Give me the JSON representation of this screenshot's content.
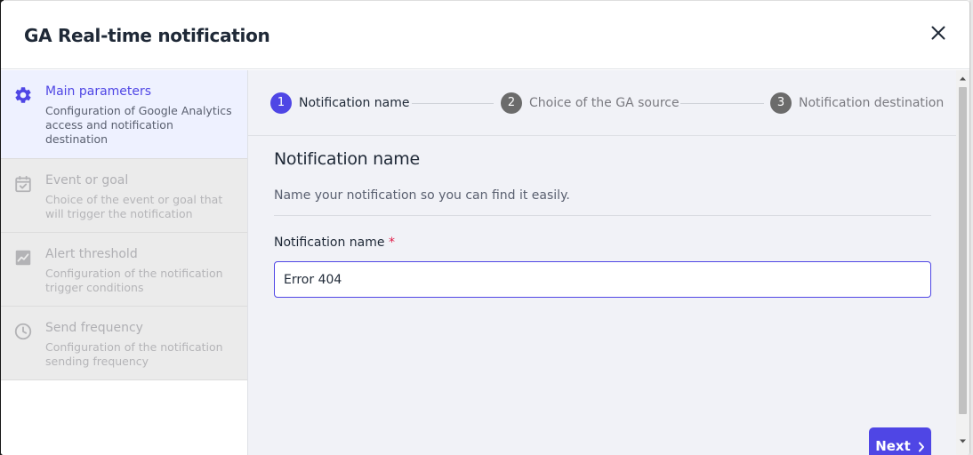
{
  "dialog": {
    "title": "GA Real-time notification"
  },
  "sidebar": {
    "items": [
      {
        "title": "Main parameters",
        "description": "Configuration of Google Analytics access and notification destination",
        "icon": "gear-icon",
        "active": true
      },
      {
        "title": "Event or goal",
        "description": "Choice of the event or goal that will trigger the notification",
        "icon": "calendar-check-icon",
        "active": false
      },
      {
        "title": "Alert threshold",
        "description": "Configuration of the notification trigger conditions",
        "icon": "chart-trend-icon",
        "active": false
      },
      {
        "title": "Send frequency",
        "description": "Configuration of the notification sending frequency",
        "icon": "clock-icon",
        "active": false
      }
    ]
  },
  "stepper": {
    "steps": [
      {
        "number": "1",
        "label": "Notification name",
        "state": "active"
      },
      {
        "number": "2",
        "label": "Choice of the GA source",
        "state": "pending"
      },
      {
        "number": "3",
        "label": "Notification destination",
        "state": "pending"
      }
    ]
  },
  "form": {
    "section_title": "Notification name",
    "section_description": "Name your notification so you can find it easily.",
    "field_label": "Notification name",
    "required_marker": "*",
    "field_value": "Error 404"
  },
  "actions": {
    "next_label": "Next",
    "next_icon": "chevron-right-icon"
  },
  "colors": {
    "accent": "#4f46e5",
    "active_bg": "#eef1ff",
    "inactive_bg": "#ebebeb",
    "step_pending": "#6b6b6b",
    "required": "#e11d48"
  }
}
